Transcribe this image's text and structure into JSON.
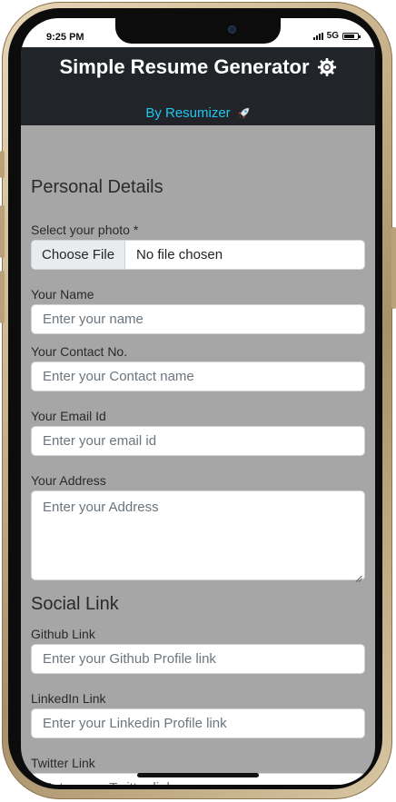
{
  "status": {
    "time": "9:25 PM",
    "network": "5G"
  },
  "header": {
    "title": "Simple Resume Generator",
    "subtitle": "By Resumizer",
    "title_icon": "gear-icon",
    "subtitle_icon": "rocket-icon",
    "subtitle_color": "#20c6f0",
    "background": "#212529"
  },
  "personal": {
    "section_title": "Personal Details",
    "photo": {
      "label": "Select your photo *",
      "button_label": "Choose File",
      "status": "No file chosen"
    },
    "name": {
      "label": "Your Name",
      "placeholder": "Enter your name"
    },
    "contact": {
      "label": "Your Contact No.",
      "placeholder": "Enter your Contact name"
    },
    "email": {
      "label": "Your Email Id",
      "placeholder": "Enter your email id"
    },
    "address": {
      "label": "Your Address",
      "placeholder": "Enter your Address"
    }
  },
  "social": {
    "section_title": "Social Link",
    "github": {
      "label": "Github Link",
      "placeholder": "Enter your Github Profile link"
    },
    "linkedin": {
      "label": "LinkedIn Link",
      "placeholder": "Enter your Linkedin Profile link"
    },
    "twitter": {
      "label": "Twitter Link",
      "placeholder": "Enter your Twitter link"
    }
  },
  "colors": {
    "page_background": "#a6a6a6",
    "header_background": "#212529"
  }
}
